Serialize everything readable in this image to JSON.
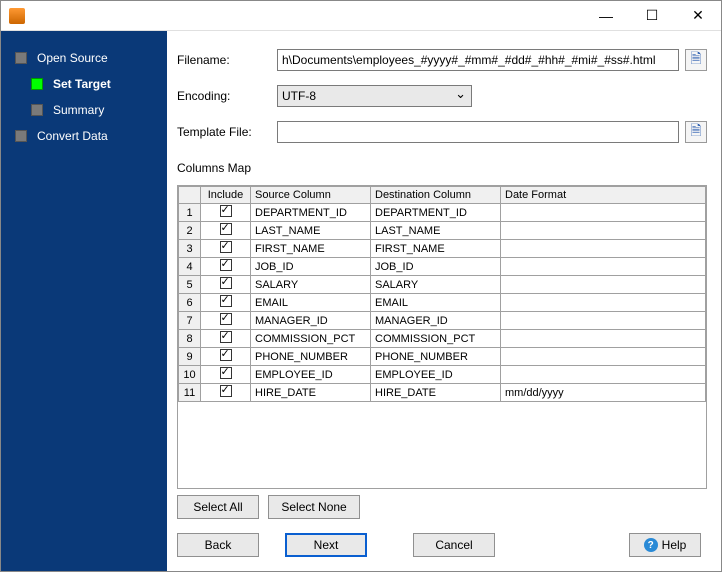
{
  "sidebar": {
    "items": [
      {
        "label": "Open Source",
        "active": false,
        "child": false
      },
      {
        "label": "Set Target",
        "active": true,
        "child": true
      },
      {
        "label": "Summary",
        "active": false,
        "child": true
      },
      {
        "label": "Convert Data",
        "active": false,
        "child": false
      }
    ]
  },
  "form": {
    "filename_label": "Filename:",
    "filename_value": "h\\Documents\\employees_#yyyy#_#mm#_#dd#_#hh#_#mi#_#ss#.html",
    "encoding_label": "Encoding:",
    "encoding_value": "UTF-8",
    "template_label": "Template File:",
    "template_value": ""
  },
  "columns_map_label": "Columns Map",
  "grid": {
    "headers": {
      "include": "Include",
      "source": "Source Column",
      "destination": "Destination Column",
      "date_format": "Date Format"
    },
    "rows": [
      {
        "n": "1",
        "include": true,
        "source": "DEPARTMENT_ID",
        "destination": "DEPARTMENT_ID",
        "date_format": ""
      },
      {
        "n": "2",
        "include": true,
        "source": "LAST_NAME",
        "destination": "LAST_NAME",
        "date_format": ""
      },
      {
        "n": "3",
        "include": true,
        "source": "FIRST_NAME",
        "destination": "FIRST_NAME",
        "date_format": ""
      },
      {
        "n": "4",
        "include": true,
        "source": "JOB_ID",
        "destination": "JOB_ID",
        "date_format": ""
      },
      {
        "n": "5",
        "include": true,
        "source": "SALARY",
        "destination": "SALARY",
        "date_format": ""
      },
      {
        "n": "6",
        "include": true,
        "source": "EMAIL",
        "destination": "EMAIL",
        "date_format": ""
      },
      {
        "n": "7",
        "include": true,
        "source": "MANAGER_ID",
        "destination": "MANAGER_ID",
        "date_format": ""
      },
      {
        "n": "8",
        "include": true,
        "source": "COMMISSION_PCT",
        "destination": "COMMISSION_PCT",
        "date_format": ""
      },
      {
        "n": "9",
        "include": true,
        "source": "PHONE_NUMBER",
        "destination": "PHONE_NUMBER",
        "date_format": ""
      },
      {
        "n": "10",
        "include": true,
        "source": "EMPLOYEE_ID",
        "destination": "EMPLOYEE_ID",
        "date_format": ""
      },
      {
        "n": "11",
        "include": true,
        "source": "HIRE_DATE",
        "destination": "HIRE_DATE",
        "date_format": "mm/dd/yyyy"
      }
    ]
  },
  "buttons": {
    "select_all": "Select All",
    "select_none": "Select None",
    "back": "Back",
    "next": "Next",
    "cancel": "Cancel",
    "help": "Help"
  }
}
